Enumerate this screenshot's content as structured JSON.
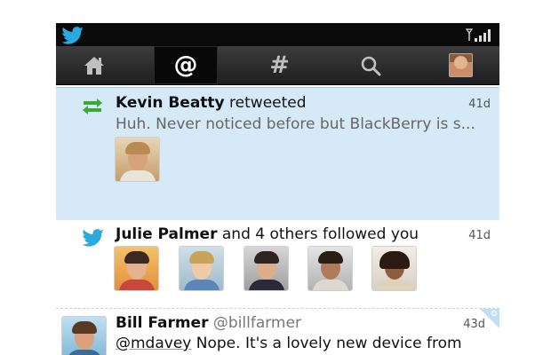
{
  "status_bar": {
    "logo_icon": "twitter-bird-icon",
    "signal_icon": "signal-strength-icon"
  },
  "tabs": [
    {
      "name": "home",
      "icon": "home-icon"
    },
    {
      "name": "mentions",
      "icon": "at-icon",
      "glyph": "@",
      "selected": true
    },
    {
      "name": "discover",
      "icon": "hashtag-icon",
      "glyph": "#"
    },
    {
      "name": "search",
      "icon": "search-icon"
    },
    {
      "name": "profile",
      "icon": "profile-avatar"
    }
  ],
  "feed": [
    {
      "type": "retweet",
      "icon": "retweet-icon",
      "name": "Kevin Beatty",
      "action": "retweeted",
      "time": "41d",
      "preview": "Huh. Never noticed before but BlackBerry is s...",
      "highlight_color": "#d6e9f7"
    },
    {
      "type": "follow",
      "icon": "twitter-bird-icon",
      "name": "Julie Palmer",
      "action": "and 4 others followed you",
      "time": "41d",
      "follower_count_shown": 5
    },
    {
      "type": "tweet",
      "name": "Bill Farmer",
      "handle": "@billfarmer",
      "time": "43d",
      "mention": "@mdavey",
      "text": "Nope. It's a lovely new device from BlackBerry"
    }
  ],
  "colors": {
    "accent": "#2aa9e0",
    "retweet_green": "#3aaa35",
    "tabbar": "#2b2b2b"
  }
}
